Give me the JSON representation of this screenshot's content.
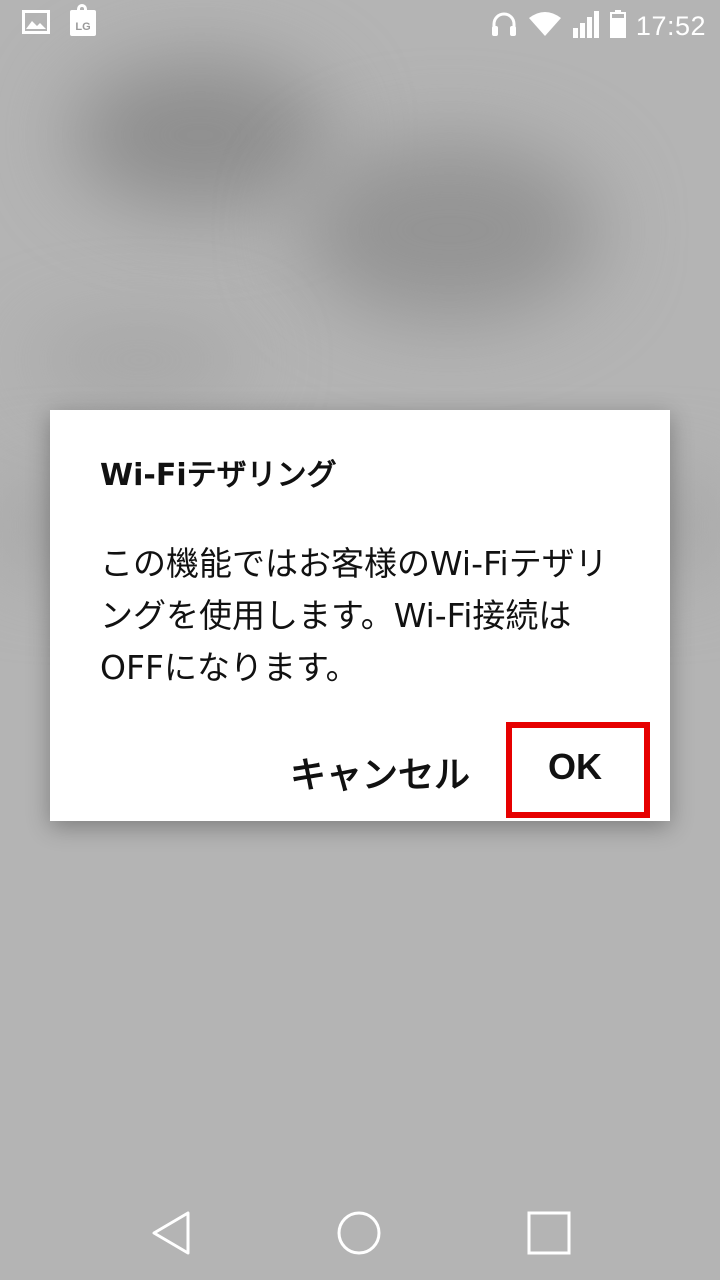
{
  "status_bar": {
    "time": "17:52",
    "lg_badge": "LG",
    "icons": [
      "gallery-icon",
      "lg-bag-icon",
      "headphones-icon",
      "wifi-icon",
      "signal-icon",
      "battery-icon"
    ]
  },
  "dialog": {
    "title": "Wi-Fiテザリング",
    "message": "この機能ではお客様のWi-Fiテザリングを使用します。Wi-Fi接続はOFFになります。",
    "cancel_label": "キャンセル",
    "ok_label": "OK"
  },
  "highlight": {
    "color": "#e60000",
    "target": "ok-button"
  },
  "nav_bar": {
    "icons": [
      "back-icon",
      "home-icon",
      "recents-icon"
    ]
  }
}
